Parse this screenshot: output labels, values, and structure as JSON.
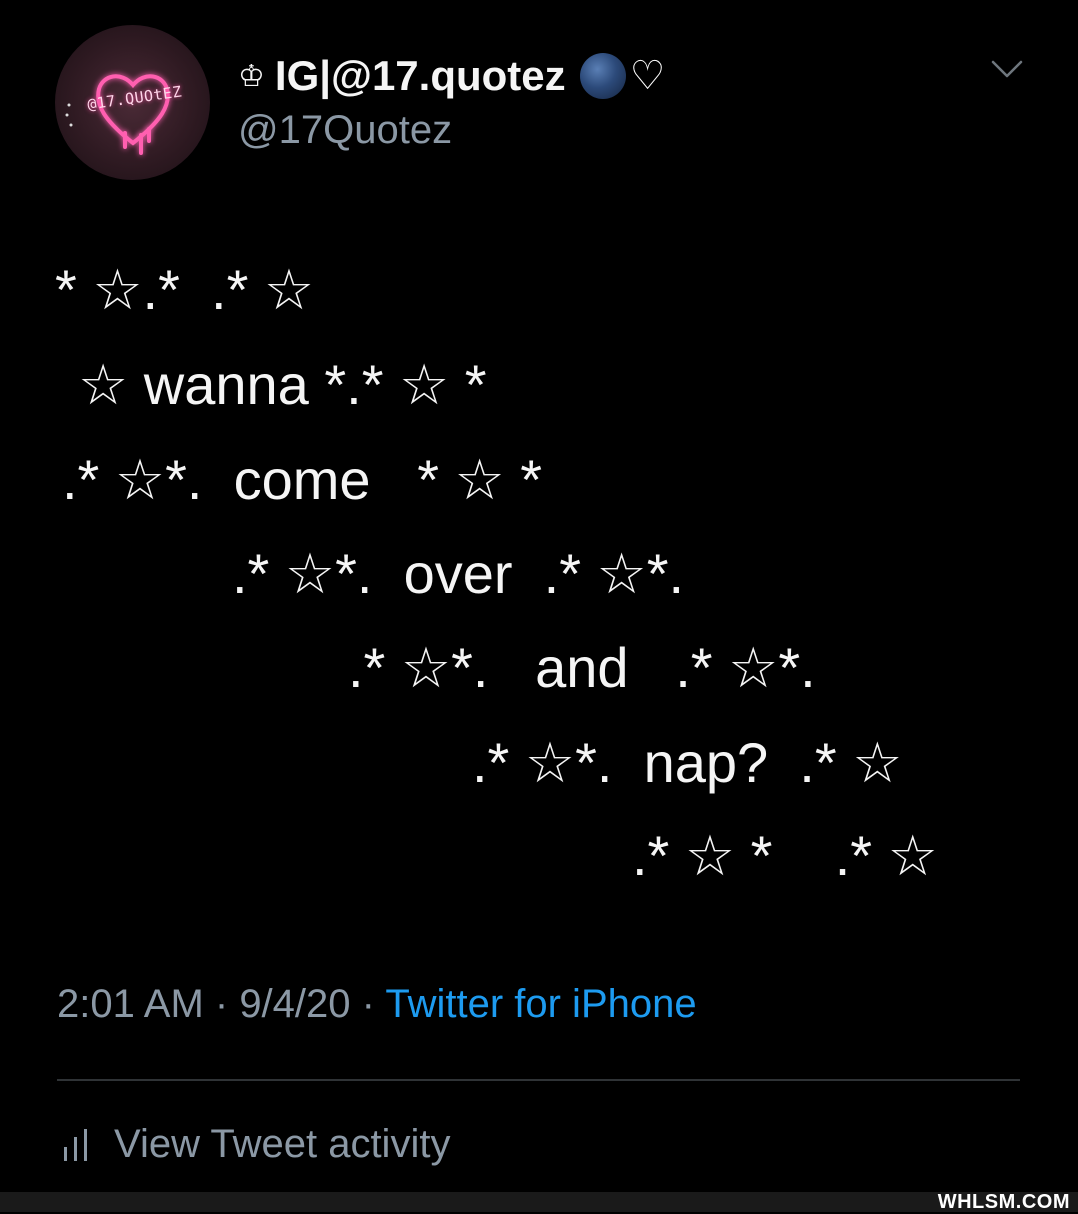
{
  "header": {
    "avatar_text": "@17.QUOtEZ",
    "name_prefix": "♔",
    "display_name": "IG|@17.quotez",
    "name_globe_icon": "globe-icon",
    "name_heart": "♡",
    "handle": "@17Quotez",
    "menu_icon": "chevron-down-icon"
  },
  "tweet": {
    "lines": [
      "* ☆.*  .* ☆",
      "☆ wanna *.* ☆ *",
      ".* ☆*.  come   * ☆ *",
      ".* ☆*.  over  .* ☆*.",
      ".* ☆*.   and   .* ☆*.",
      ".* ☆*.  nap?  .* ☆",
      ".* ☆ *    .* ☆"
    ]
  },
  "meta": {
    "time": "2:01 AM",
    "separator1": " · ",
    "date": "9/4/20",
    "separator2": " · ",
    "source": "Twitter for iPhone"
  },
  "activity": {
    "label": "View Tweet activity",
    "icon": "bar-chart-icon"
  },
  "watermark": "WHLSM.COM",
  "colors": {
    "background": "#000000",
    "text": "#f5f5f5",
    "secondary": "#8b98a5",
    "link": "#1d9bf0",
    "neon": "#ff4fa3"
  }
}
